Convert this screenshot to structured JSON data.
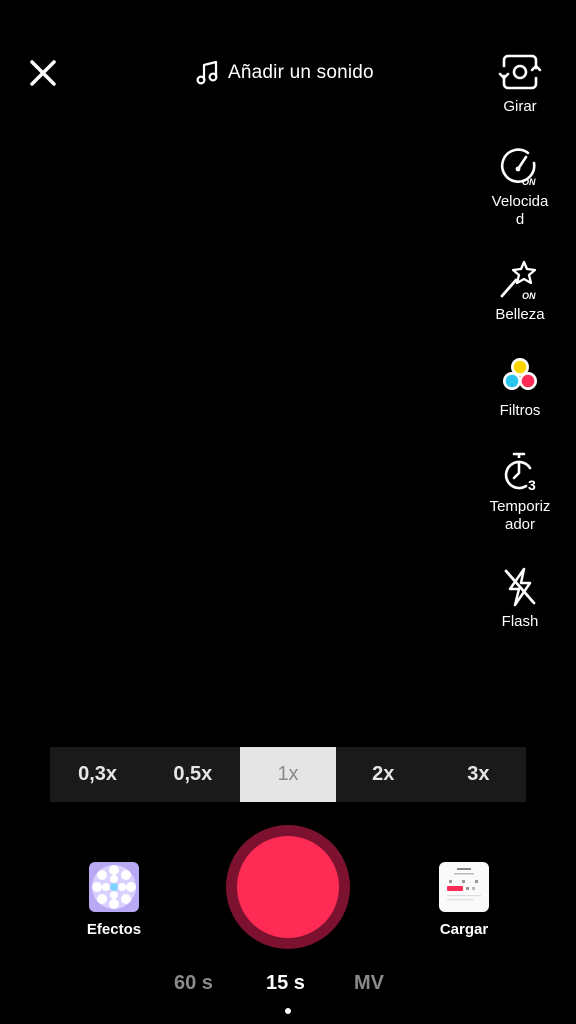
{
  "top": {
    "close_icon": "close-icon",
    "sound_label": "Añadir un sonido",
    "sound_icon": "music-note-icon"
  },
  "tools": [
    {
      "label": "Girar",
      "icon": "flip-camera-icon"
    },
    {
      "label": "Velocidad",
      "icon": "speed-icon",
      "badge": "ON"
    },
    {
      "label": "Belleza",
      "icon": "magic-wand-icon",
      "badge": "ON"
    },
    {
      "label": "Filtros",
      "icon": "filters-icon"
    },
    {
      "label": "Temporizador",
      "icon": "timer-icon",
      "badge": "3"
    },
    {
      "label": "Flash",
      "icon": "flash-off-icon"
    }
  ],
  "speed": {
    "options": [
      "0,3x",
      "0,5x",
      "1x",
      "2x",
      "3x"
    ],
    "selected": "1x"
  },
  "bottom": {
    "effects_label": "Efectos",
    "upload_label": "Cargar"
  },
  "modes": {
    "items": [
      "60 s",
      "15 s",
      "MV"
    ],
    "selected": "15 s"
  },
  "colors": {
    "record": "#fe2c55",
    "record_ring": "#7d1230",
    "background": "#000000"
  }
}
